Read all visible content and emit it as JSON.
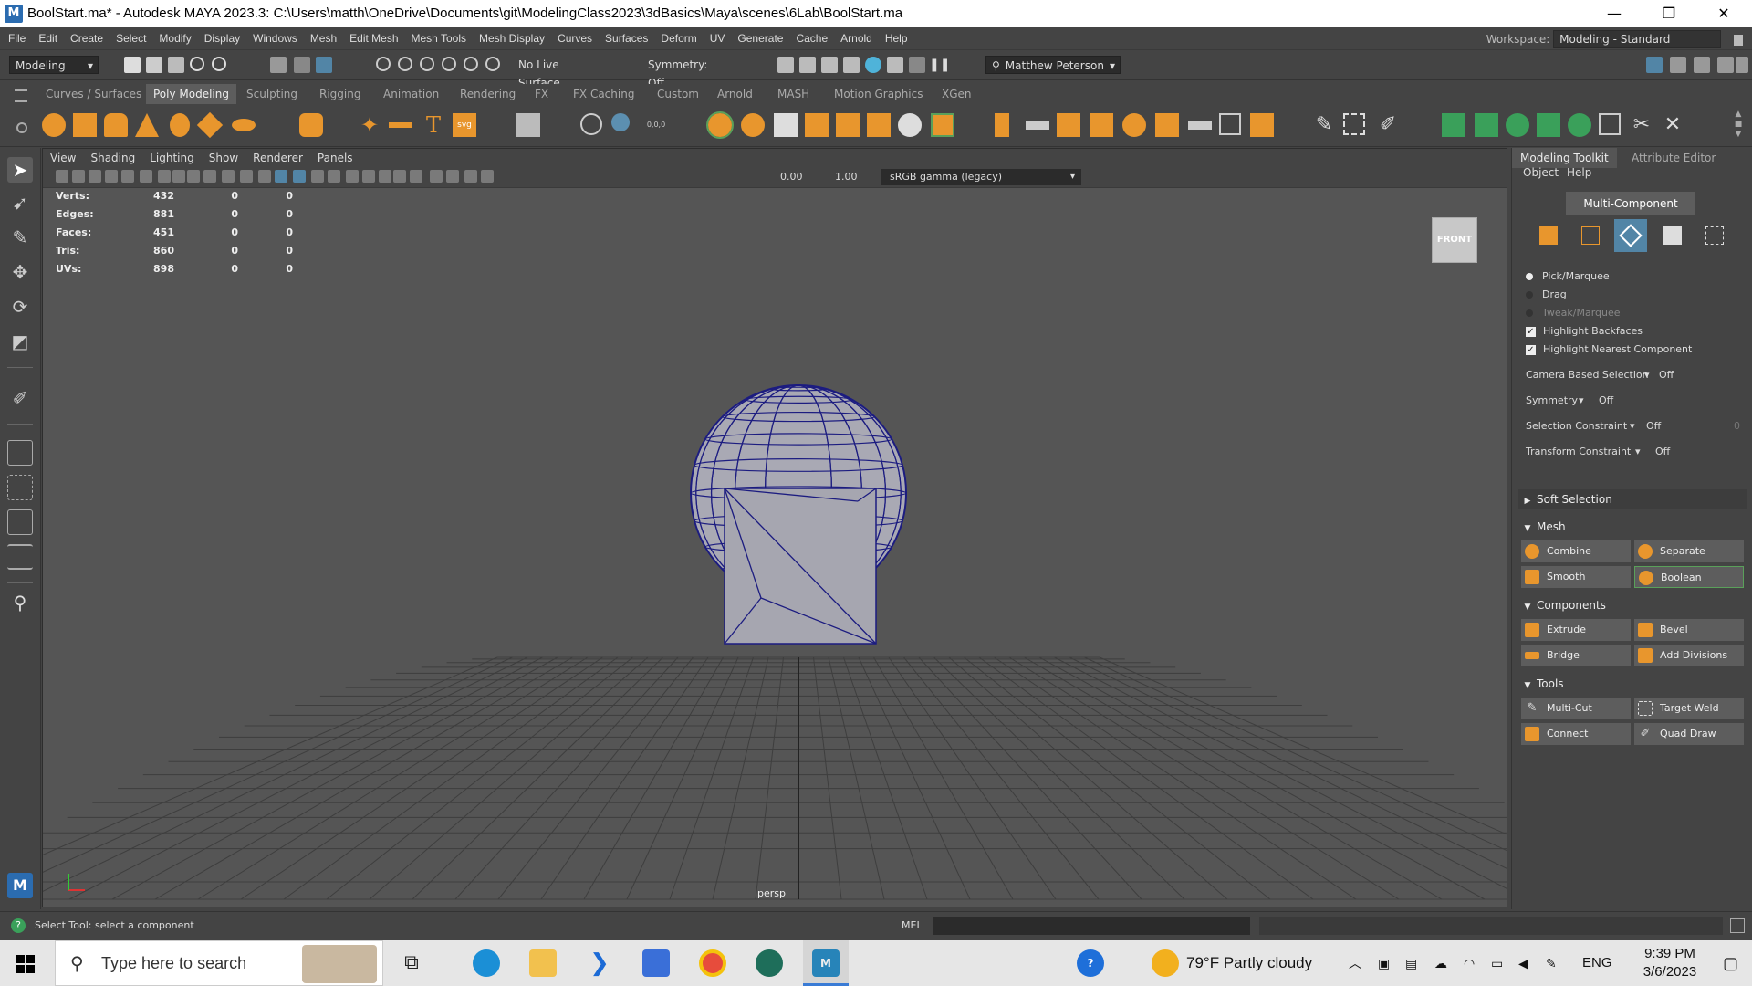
{
  "window": {
    "title": "BoolStart.ma* - Autodesk MAYA 2023.3: C:\\Users\\matth\\OneDrive\\Documents\\git\\ModelingClass2023\\3dBasics\\Maya\\scenes\\6Lab\\BoolStart.ma",
    "app_icon_letter": "M",
    "minimize_glyph": "—",
    "restore_glyph": "❐",
    "close_glyph": "✕"
  },
  "menubar": {
    "items": [
      "File",
      "Edit",
      "Create",
      "Select",
      "Modify",
      "Display",
      "Windows",
      "Mesh",
      "Edit Mesh",
      "Mesh Tools",
      "Mesh Display",
      "Curves",
      "Surfaces",
      "Deform",
      "UV",
      "Generate",
      "Cache",
      "Arnold",
      "Help"
    ],
    "workspace_label": "Workspace:",
    "workspace_value": "Modeling - Standard"
  },
  "statusline": {
    "menuset": "Modeling",
    "live_surface": "No Live Surface",
    "symmetry": "Symmetry: Off",
    "user": "Matthew Peterson"
  },
  "shelf": {
    "tabs": [
      "Curves / Surfaces",
      "Poly Modeling",
      "Sculpting",
      "Rigging",
      "Animation",
      "Rendering",
      "FX",
      "FX Caching",
      "Custom",
      "Arnold",
      "MASH",
      "Motion Graphics",
      "XGen"
    ],
    "active_tab": "Poly Modeling",
    "coord_text": "0,0,0"
  },
  "viewport": {
    "menus": [
      "View",
      "Shading",
      "Lighting",
      "Show",
      "Renderer",
      "Panels"
    ],
    "exposure": "0.00",
    "gamma": "1.00",
    "color_space": "sRGB gamma (legacy)",
    "viewcube_label": "FRONT",
    "camera": "persp",
    "hud": [
      {
        "label": "Verts:",
        "v1": "432",
        "v2": "0",
        "v3": "0"
      },
      {
        "label": "Edges:",
        "v1": "881",
        "v2": "0",
        "v3": "0"
      },
      {
        "label": "Faces:",
        "v1": "451",
        "v2": "0",
        "v3": "0"
      },
      {
        "label": "Tris:",
        "v1": "860",
        "v2": "0",
        "v3": "0"
      },
      {
        "label": "UVs:",
        "v1": "898",
        "v2": "0",
        "v3": "0"
      }
    ]
  },
  "toolkit": {
    "tabs": [
      "Modeling Toolkit",
      "Attribute Editor"
    ],
    "submenus": [
      "Object",
      "Help"
    ],
    "multi_component": "Multi-Component",
    "pick_marquee": "Pick/Marquee",
    "drag": "Drag",
    "tweak_marquee": "Tweak/Marquee",
    "highlight_backfaces": "Highlight Backfaces",
    "highlight_nearest": "Highlight Nearest Component",
    "camera_based_selection": "Camera Based Selection",
    "camera_based_value": "Off",
    "symmetry": "Symmetry",
    "symmetry_value": "Off",
    "selection_constraint": "Selection Constraint",
    "selection_constraint_value": "Off",
    "selection_constraint_num": "0",
    "transform_constraint": "Transform Constraint",
    "transform_constraint_value": "Off",
    "soft_selection": "Soft Selection",
    "mesh_section": "Mesh",
    "combine": "Combine",
    "separate": "Separate",
    "smooth": "Smooth",
    "boolean": "Boolean",
    "components_section": "Components",
    "extrude": "Extrude",
    "bevel": "Bevel",
    "bridge": "Bridge",
    "add_divisions": "Add Divisions",
    "tools_section": "Tools",
    "multi_cut": "Multi-Cut",
    "target_weld": "Target Weld",
    "connect": "Connect",
    "quad_draw": "Quad Draw"
  },
  "cmdline": {
    "help_text": "Select Tool: select a component",
    "lang": "MEL"
  },
  "taskbar": {
    "search_placeholder": "Type here to search",
    "weather": "79°F  Partly cloudy",
    "lang": "ENG",
    "time": "9:39 PM",
    "date": "3/6/2023"
  },
  "colors": {
    "maya_bg": "#444444",
    "viewport_bg": "#555555",
    "accent_blue": "#5285a6",
    "highlight_green": "#5aa05a",
    "wire_blue": "#1c1c80"
  }
}
